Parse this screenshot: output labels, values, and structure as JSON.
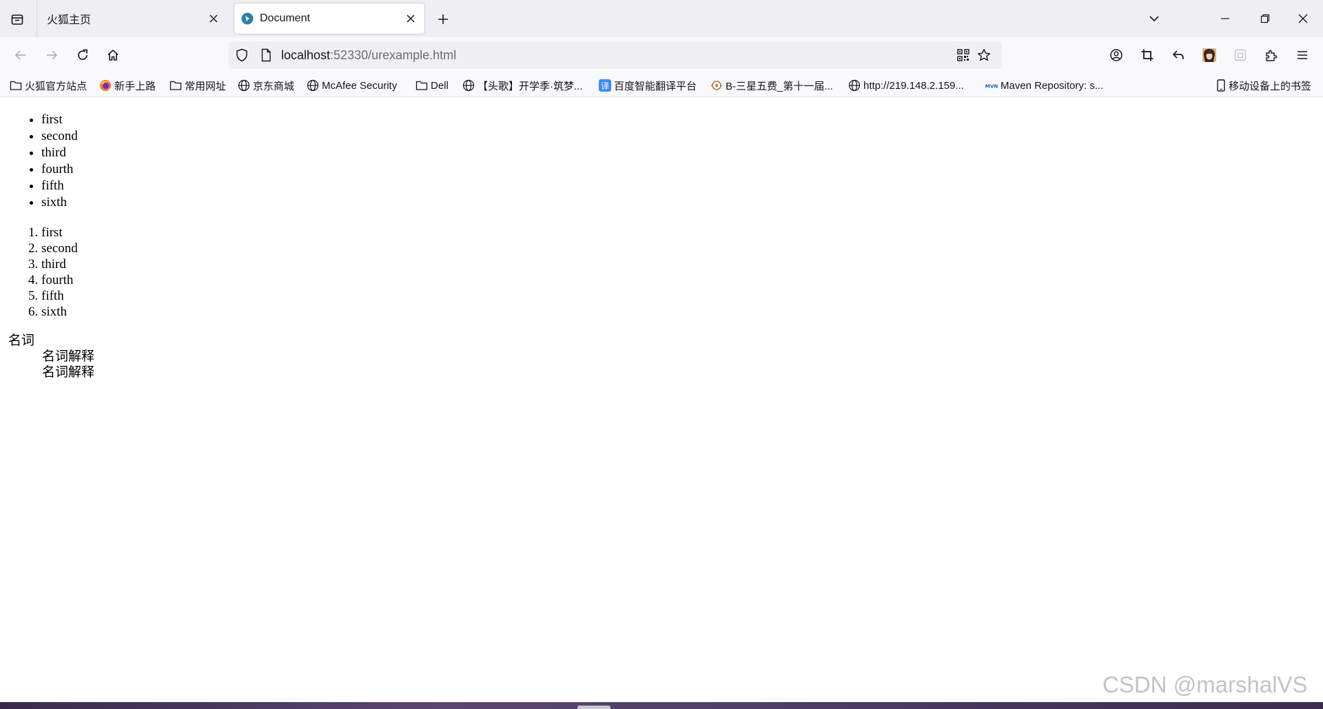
{
  "browser": {
    "tabs": [
      {
        "title": "火狐主页",
        "active": false
      },
      {
        "title": "Document",
        "active": true
      }
    ],
    "url": {
      "host": "localhost",
      "rest": ":52330/urexample.html"
    },
    "bookmarks": [
      {
        "label": "火狐官方站点",
        "icon": "folder-icon"
      },
      {
        "label": "新手上路",
        "icon": "firefox-icon"
      },
      {
        "label": "常用网址",
        "icon": "folder-icon"
      },
      {
        "label": "京东商城",
        "icon": "globe-icon"
      },
      {
        "label": "McAfee Security",
        "icon": "globe-icon"
      },
      {
        "label": "Dell",
        "icon": "folder-icon"
      },
      {
        "label": "【头歌】开学季·筑梦...",
        "icon": "globe-icon"
      },
      {
        "label": "百度智能翻译平台",
        "icon": "translate-icon"
      },
      {
        "label": "B-三星五费_第十一届...",
        "icon": "site-icon"
      },
      {
        "label": "http://219.148.2.159...",
        "icon": "globe-icon"
      },
      {
        "label": "Maven Repository: s...",
        "icon": "maven-icon"
      }
    ],
    "mobile_bookmarks": "移动设备上的书签"
  },
  "page": {
    "unordered_list": [
      "first",
      "second",
      "third",
      "fourth",
      "fifth",
      "sixth"
    ],
    "ordered_list": [
      "first",
      "second",
      "third",
      "fourth",
      "fifth",
      "sixth"
    ],
    "definition_list": {
      "term": "名词",
      "definitions": [
        "名词解释",
        "名词解释"
      ]
    }
  },
  "watermark": "CSDN @marshalVS",
  "colors": {
    "tabstrip_bg": "#efeff3",
    "toolbar_bg": "#f9f9fb",
    "urlbar_bg": "#f0f0f4",
    "favicon_accent": "#2f7fa8",
    "translate_icon_bg": "#3d8af7"
  }
}
